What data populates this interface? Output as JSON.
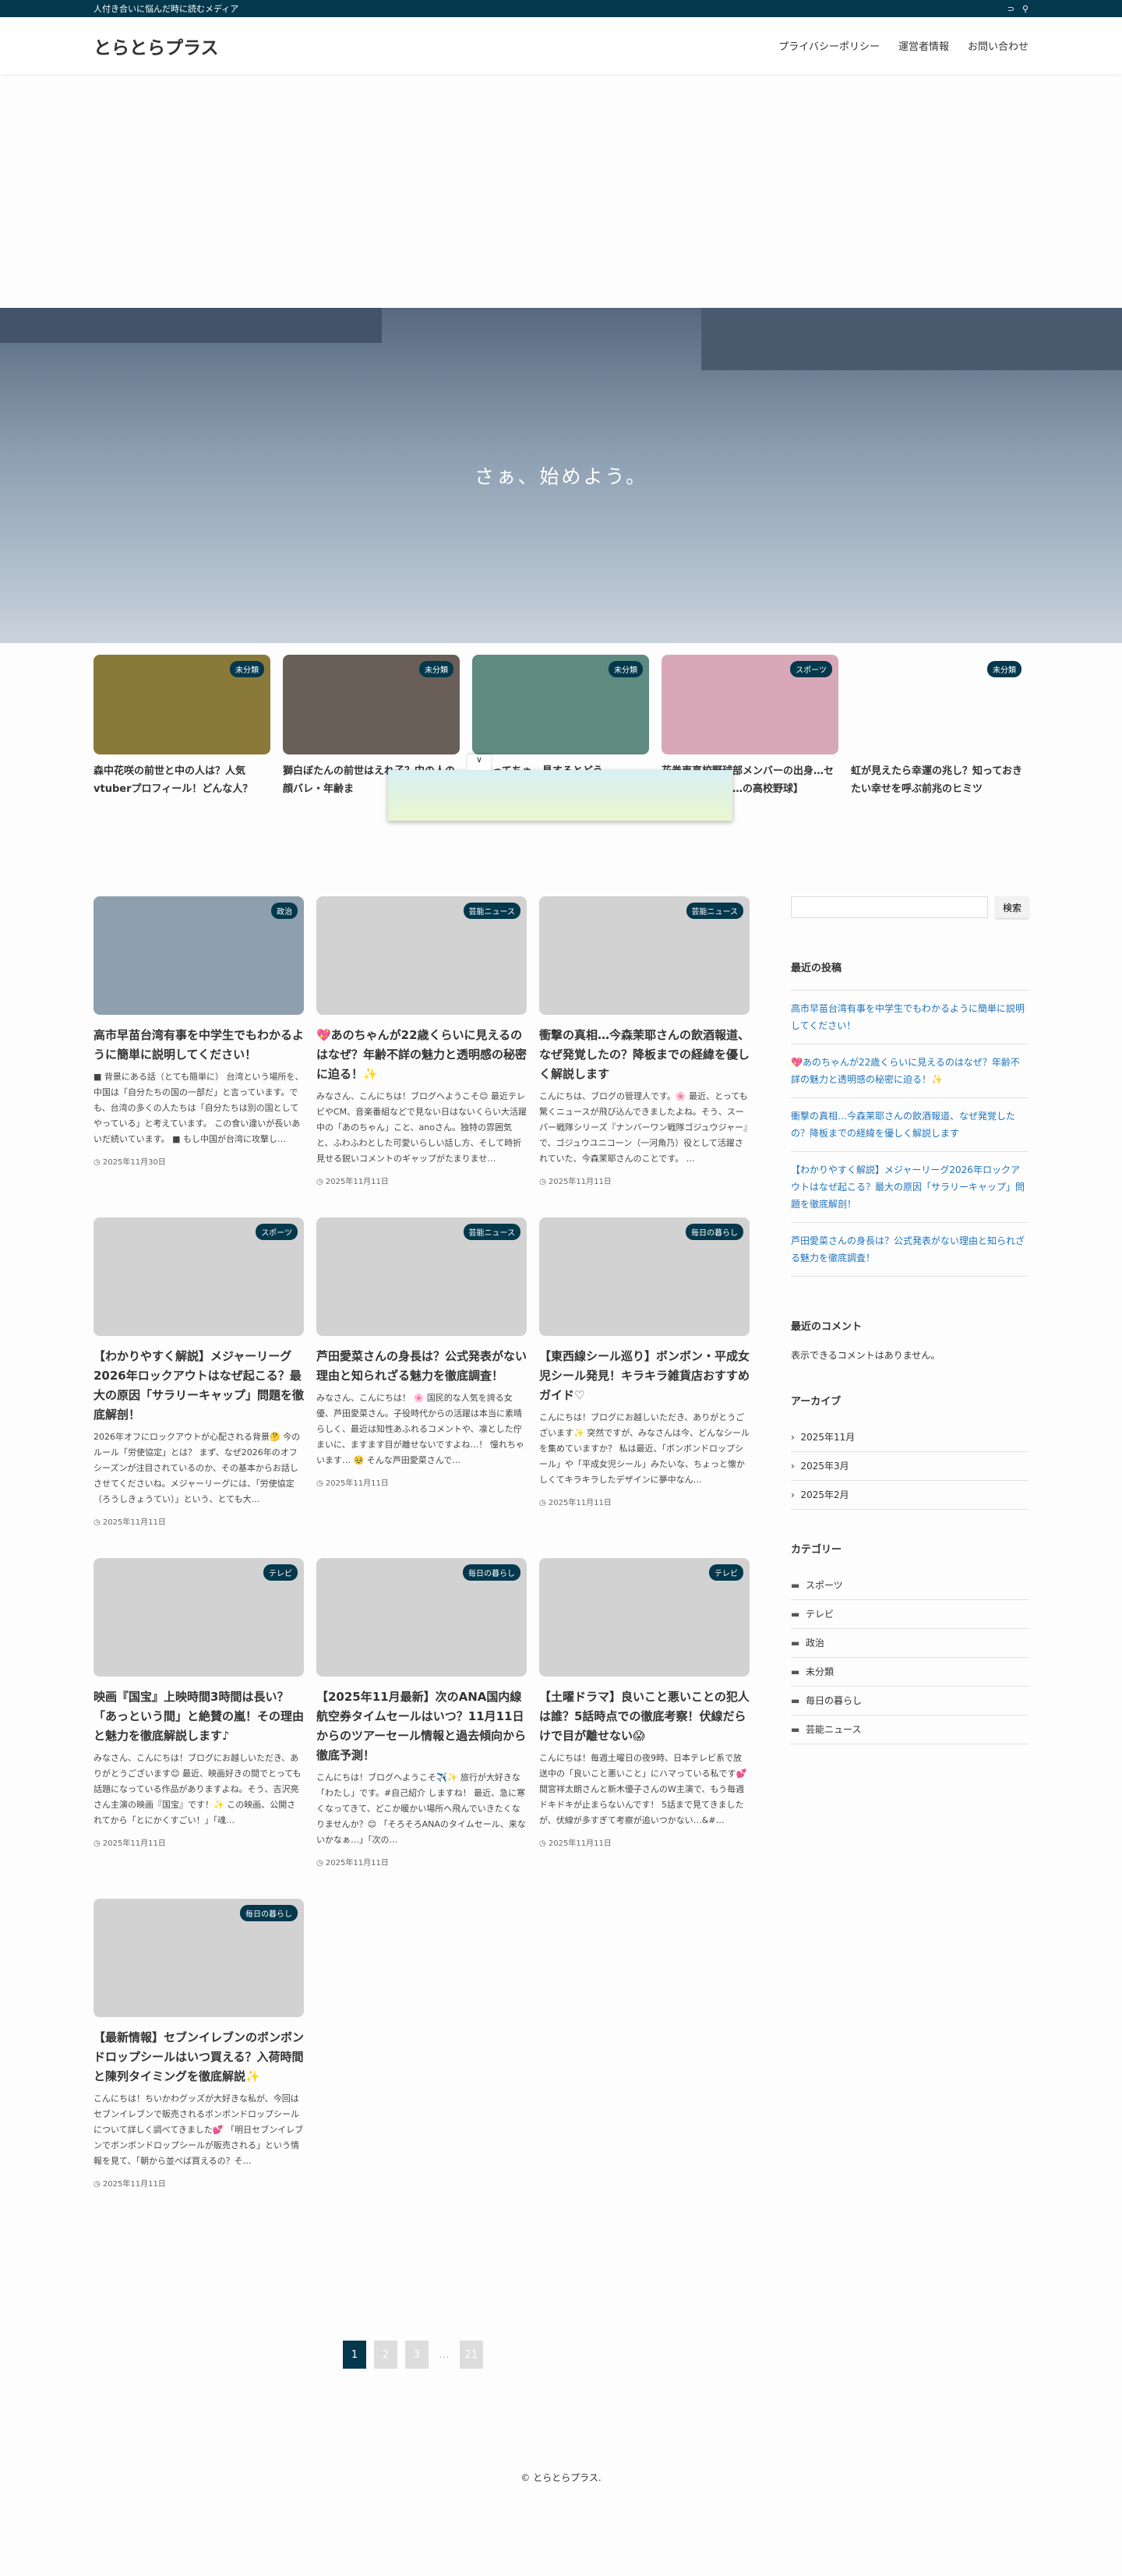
{
  "topbar": {
    "tagline": "人付き合いに悩んだ時に読むメディア",
    "icons": [
      "rss-icon",
      "search-icon"
    ]
  },
  "header": {
    "logo": "とらとらプラス",
    "nav": [
      "プライバシーポリシー",
      "運営者情報",
      "お問い合わせ"
    ]
  },
  "hero": {
    "text": "さぁ、始めよう。"
  },
  "pickup": [
    {
      "cat": "未分類",
      "title": "森中花咲の前世と中の人は？人気vtuberプロフィール！どんな人？",
      "color": "#8a7a3a"
    },
    {
      "cat": "未分類",
      "title": "獅白ぼたんの前世はえれ子？中の人の顔バレ・年齢ま",
      "color": "#6a5f58"
    },
    {
      "cat": "未分類",
      "title": "かまってちゃ…見するとどう",
      "color": "#5e8a80"
    },
    {
      "cat": "スポーツ",
      "title": "花巻東高校野球部メンバーの出身…センバツ甲子園出…の高校野球】",
      "color": "#d8a8b8"
    },
    {
      "cat": "未分類",
      "title": "虹が見えたら幸運の兆し？知っておきたい幸せを呼ぶ前兆のヒミツ",
      "color": "#fdfdfd"
    }
  ],
  "ad": {
    "collapse": "∨"
  },
  "posts": [
    {
      "cat": "政治",
      "title": "高市早苗台湾有事を中学生でもわかるように簡単に説明してください！",
      "excerpt": "■ 背景にある話（とても簡単に） 台湾という場所を、中国は「自分たちの国の一部だ」と言っています。でも、台湾の多くの人たちは「自分たちは別の国としてやっている」と考えています。 この食い違いが長いあいだ続いています。 ■ もし中国が台湾に攻撃し…",
      "date": "2025年11月30日",
      "thumb": "#8ea0ae"
    },
    {
      "cat": "芸能ニュース",
      "title": "💖あのちゃんが22歳くらいに見えるのはなぜ？年齢不詳の魅力と透明感の秘密に迫る！✨",
      "excerpt": "みなさん、こんにちは！ブログへようこそ😊 最近テレビやCM、音楽番組などで見ない日はないくらい大活躍中の「あのちゃん」こと、anoさん。独特の雰囲気と、ふわふわとした可愛いらしい話し方、そして時折見せる鋭いコメントのギャップがたまりませ…",
      "date": "2025年11月11日"
    },
    {
      "cat": "芸能ニュース",
      "title": "衝撃の真相…今森茉耶さんの飲酒報道、なぜ発覚したの？降板までの経緯を優しく解説します",
      "excerpt": "こんにちは、ブログの管理人です。🌸 最近、とっても驚くニュースが飛び込んできましたよね。そう、スーパー戦隊シリーズ『ナンバーワン戦隊ゴジュウジャー』で、ゴジュウユニコーン（一河角乃）役として活躍されていた、今森茉耶さんのことです。 …",
      "date": "2025年11月11日"
    },
    {
      "cat": "スポーツ",
      "title": "【わかりやすく解説】メジャーリーグ2026年ロックアウトはなぜ起こる？最大の原因「サラリーキャップ」問題を徹底解剖！",
      "excerpt": "2026年オフにロックアウトが心配される背景🤔 今のルール「労使協定」とは？ まず、なぜ2026年のオフシーズンが注目されているのか、その基本からお話しさせてくださいね。メジャーリーグには、「労使協定（ろうしきょうてい）」という、とても大…",
      "date": "2025年11月11日"
    },
    {
      "cat": "芸能ニュース",
      "title": "芦田愛菜さんの身長は？公式発表がない理由と知られざる魅力を徹底調査！",
      "excerpt": "みなさん、こんにちは！ 🌸 国民的な人気を誇る女優、芦田愛菜さん。子役時代からの活躍は本当に素晴らしく、最近は知性あふれるコメントや、凛とした佇まいに、ますます目が離せないですよね…！ 憧れちゃいます… 🥹 そんな芦田愛菜さんで…",
      "date": "2025年11月11日"
    },
    {
      "cat": "毎日の暮らし",
      "title": "【東西線シール巡り】ボンボン・平成女児シール発見！キラキラ雑貨店おすすめガイド♡",
      "excerpt": "こんにちは！ブログにお越しいただき、ありがとうございます✨ 突然ですが、みなさんは今、どんなシールを集めていますか？ 私は最近、「ボンボンドロップシール」や「平成女児シール」みたいな、ちょっと懐かしくてキラキラしたデザインに夢中なん…",
      "date": "2025年11月11日"
    },
    {
      "cat": "テレビ",
      "title": "映画『国宝』上映時間3時間は長い？「あっという間」と絶賛の嵐！その理由と魅力を徹底解説します♪",
      "excerpt": "みなさん、こんにちは！ブログにお越しいただき、ありがとうございます😊 最近、映画好きの間でとっても話題になっている作品がありますよね。そう、吉沢亮さん主演の映画『国宝』です！✨ この映画、公開されてから「とにかくすごい！」「魂…",
      "date": "2025年11月11日"
    },
    {
      "cat": "毎日の暮らし",
      "title": "【2025年11月最新】次のANA国内線航空券タイムセールはいつ？11月11日からのツアーセール情報と過去傾向から徹底予測！",
      "excerpt": "こんにちは！ブログへようこそ✈️✨ 旅行が大好きな「わたし」です。#自己紹介 しますね！ 最近、急に寒くなってきて、どこか暖かい場所へ飛んでいきたくなりませんか？😊 「そろそろANAのタイムセール、来ないかなぁ…」「次の…",
      "date": "2025年11月11日"
    },
    {
      "cat": "テレビ",
      "title": "【土曜ドラマ】良いこと悪いことの犯人は誰？5話時点での徹底考察！伏線だらけで目が離せない😱",
      "excerpt": "こんにちは！毎週土曜日の夜9時、日本テレビ系で放送中の「良いこと悪いこと」にハマっている私です💕 間宮祥太朗さんと新木優子さんのW主演で、もう毎週ドキドキが止まらないんです！ 5話まで見てきましたが、伏線が多すぎて考察が追いつかない…&#…",
      "date": "2025年11月11日"
    },
    {
      "cat": "毎日の暮らし",
      "title": "【最新情報】セブンイレブンのボンボンドロップシールはいつ買える？入荷時間と陳列タイミングを徹底解説✨",
      "excerpt": "こんにちは！ちいかわグッズが大好きな私が、今回はセブンイレブンで販売されるボンボンドロップシールについて詳しく調べてきました💕 「明日セブンイレブンでボンボンドロップシールが販売される」という情報を見て、「朝から並べば買えるの？そ…",
      "date": "2025年11月11日"
    }
  ],
  "sidebar": {
    "search_button": "検索",
    "recent_title": "最近の投稿",
    "recent": [
      "高市早苗台湾有事を中学生でもわかるように簡単に説明してください！",
      "💖あのちゃんが22歳くらいに見えるのはなぜ？年齢不詳の魅力と透明感の秘密に迫る！✨",
      "衝撃の真相…今森茉耶さんの飲酒報道、なぜ発覚したの？降板までの経緯を優しく解説します",
      "【わかりやすく解説】メジャーリーグ2026年ロックアウトはなぜ起こる？最大の原因「サラリーキャップ」問題を徹底解剖！",
      "芦田愛菜さんの身長は？公式発表がない理由と知られざる魅力を徹底調査！"
    ],
    "comments_title": "最近のコメント",
    "comments_empty": "表示できるコメントはありません。",
    "archive_title": "アーカイブ",
    "archives": [
      "2025年11月",
      "2025年3月",
      "2025年2月"
    ],
    "category_title": "カテゴリー",
    "categories": [
      "スポーツ",
      "テレビ",
      "政治",
      "未分類",
      "毎日の暮らし",
      "芸能ニュース"
    ]
  },
  "pagination": {
    "pages": [
      "1",
      "2",
      "3"
    ],
    "dots": "…",
    "last": "21",
    "current": "1"
  },
  "footer": {
    "copyright": "© とらとらプラス."
  },
  "colors": {
    "accent": "#04384c",
    "link": "#1e73be"
  }
}
